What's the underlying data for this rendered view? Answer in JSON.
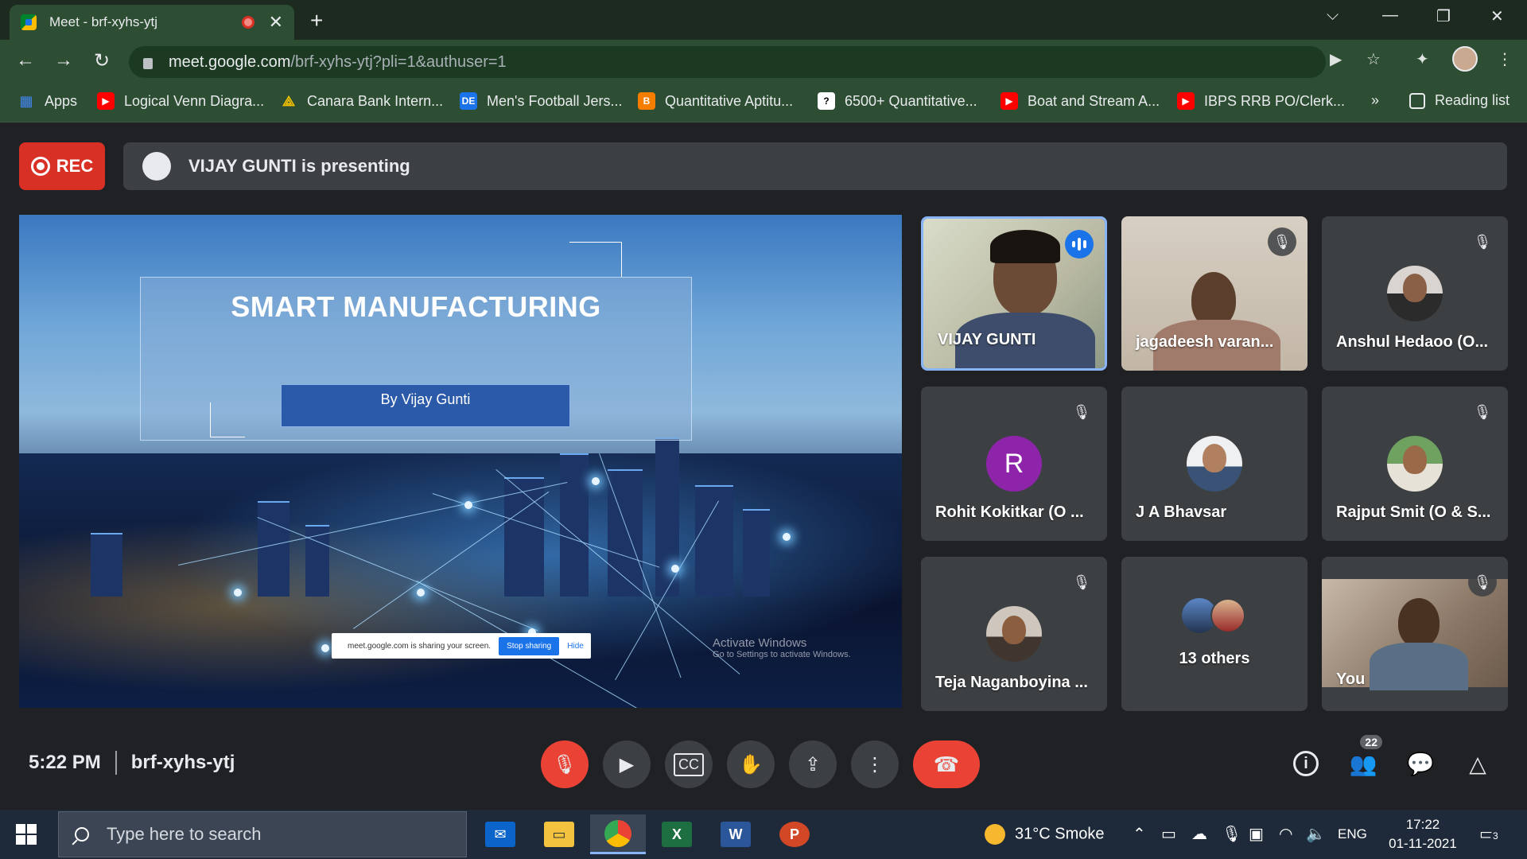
{
  "browser": {
    "tab_title": "Meet - brf-xyhs-ytj",
    "url_host": "meet.google.com",
    "url_path": "/brf-xyhs-ytj?pli=1&authuser=1",
    "bookmarks": [
      {
        "label": "Apps",
        "icon": "apps-grid-icon",
        "color": "#4285f4"
      },
      {
        "label": "Logical Venn Diagra...",
        "icon": "youtube-icon",
        "color": "#ff0000"
      },
      {
        "label": "Canara Bank Intern...",
        "icon": "canara-icon",
        "color": "#f2c200"
      },
      {
        "label": "Men's Football Jers...",
        "icon": "de-icon",
        "color": "#1a73e8"
      },
      {
        "label": "Quantitative Aptitu...",
        "icon": "blogger-icon",
        "color": "#f57d00"
      },
      {
        "label": "6500+ Quantitative...",
        "icon": "site-icon",
        "color": "#ffffff"
      },
      {
        "label": "Boat and Stream A...",
        "icon": "youtube-icon",
        "color": "#ff0000"
      },
      {
        "label": "IBPS RRB PO/Clerk...",
        "icon": "youtube-icon",
        "color": "#ff0000"
      }
    ],
    "more_bookmarks": "»",
    "reading_list": "Reading list"
  },
  "meet": {
    "rec_label": "REC",
    "presenting_text": "VIJAY GUNTI is presenting",
    "slide": {
      "title": "SMART MANUFACTURING",
      "author": "By Vijay Gunti",
      "share_notice": "meet.google.com is sharing your screen.",
      "stop_sharing": "Stop sharing",
      "hide": "Hide",
      "activate_title": "Activate Windows",
      "activate_sub": "Go to Settings to activate Windows."
    },
    "participants": [
      {
        "name": "VIJAY GUNTI",
        "type": "video",
        "state": "speaking"
      },
      {
        "name": "jagadeesh varan...",
        "type": "video",
        "state": "muted"
      },
      {
        "name": "Anshul Hedaoo (O...",
        "type": "avatar",
        "state": "muted"
      },
      {
        "name": "Rohit Kokitkar (O ...",
        "type": "initial",
        "initial": "R",
        "state": "muted"
      },
      {
        "name": "J A Bhavsar",
        "type": "avatar",
        "state": "none"
      },
      {
        "name": "Rajput Smit (O & S...",
        "type": "avatar",
        "state": "muted"
      },
      {
        "name": "Teja Naganboyina ...",
        "type": "avatar",
        "state": "muted"
      },
      {
        "name": "13 others",
        "type": "group",
        "state": "none"
      },
      {
        "name": "You",
        "type": "video",
        "state": "muted"
      }
    ],
    "time": "5:22 PM",
    "meeting_code": "brf-xyhs-ytj",
    "people_count": "22",
    "accent": "#8ab4f8",
    "end_call_color": "#ea4335"
  },
  "taskbar": {
    "search_placeholder": "Type here to search",
    "weather": "31°C  Smoke",
    "language": "ENG",
    "time": "17:22",
    "date": "01-11-2021",
    "notification_count": "3"
  }
}
